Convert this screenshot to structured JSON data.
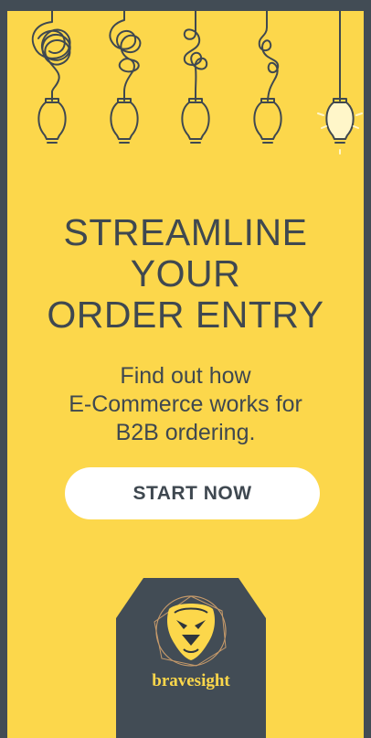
{
  "headline": {
    "line1": "STREAMLINE",
    "line2": "YOUR",
    "line3": "ORDER ENTRY"
  },
  "subtext": {
    "line1": "Find out how",
    "line2": "E-Commerce works for",
    "line3": "B2B ordering."
  },
  "cta": {
    "label": "START NOW"
  },
  "brand": {
    "name": "bravesight"
  },
  "colors": {
    "background": "#fcd74b",
    "frame": "#424c55",
    "text": "#3f4850",
    "button": "#ffffff"
  },
  "icons": [
    "tangled-cord-bulb-icon",
    "lit-bulb-icon",
    "lion-logo-icon"
  ]
}
